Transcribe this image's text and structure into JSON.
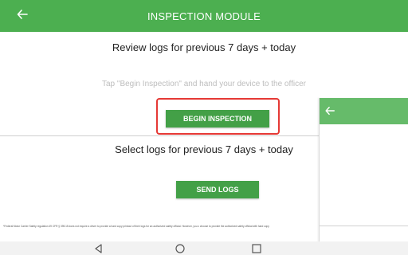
{
  "header": {
    "title": "INSPECTION MODULE",
    "back_icon": "arrow-left-icon",
    "color": "#4caf50"
  },
  "review": {
    "heading": "Review logs for previous 7 days + today",
    "hint": "Tap \"Begin Inspection\" and hand your device to the officer",
    "button_label": "BEGIN INSPECTION",
    "highlight_color": "#e53935"
  },
  "send": {
    "heading": "Select logs for previous 7 days + today",
    "button_label": "SEND LOGS"
  },
  "footnote": "*Federal Motor Carrier Safety regulation 49 CFR § 395.15 does not require a driver to provide a hard copy printout of their logs for an authorized safety official. However, you c choose to provide the authorized safety official with hard copy",
  "overlay": {
    "back_icon": "arrow-left-icon",
    "color": "#66bb6a"
  },
  "navbar": {
    "icons": [
      "triangle-back-icon",
      "circle-home-icon",
      "square-recents-icon"
    ]
  }
}
